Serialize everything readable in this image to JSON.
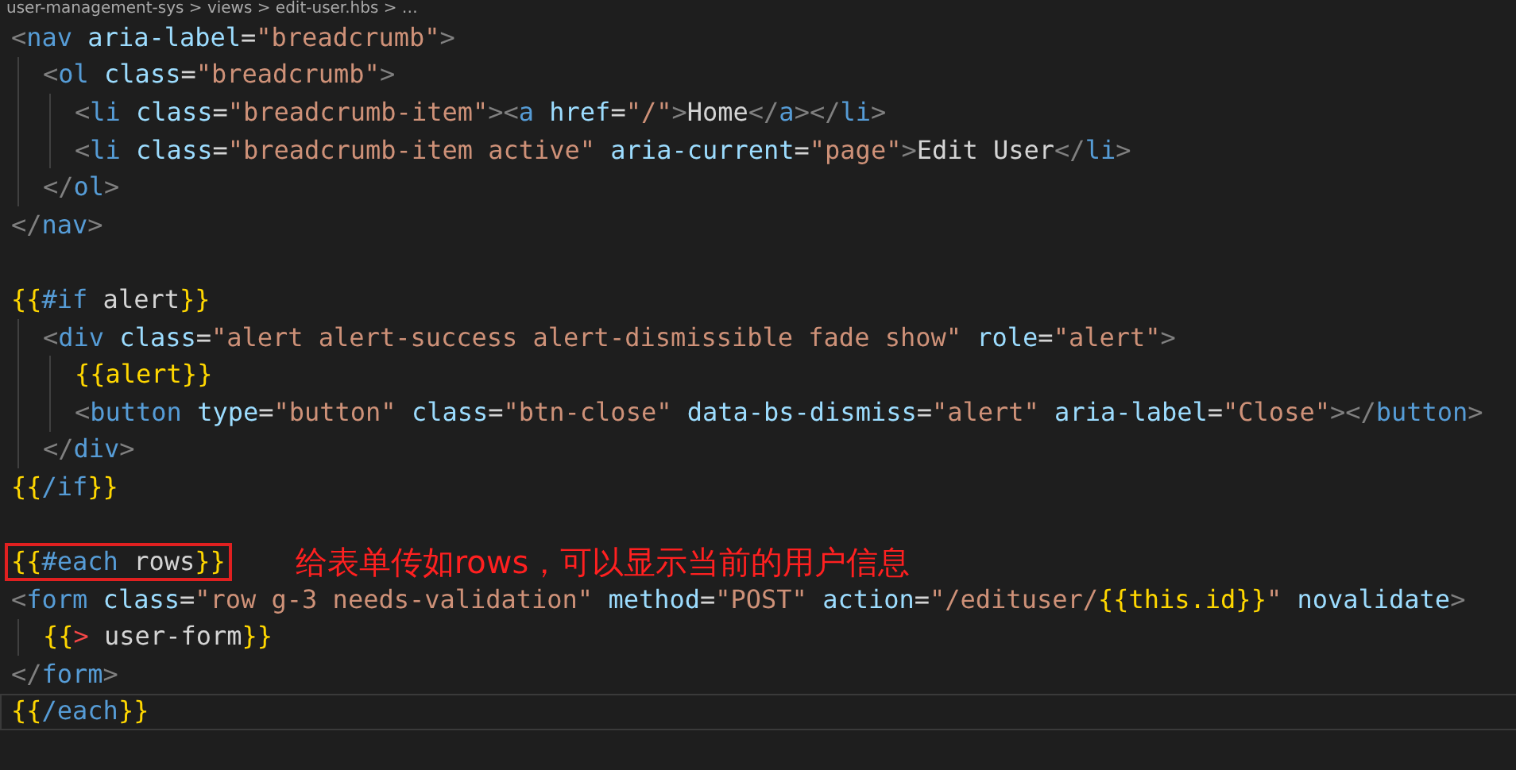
{
  "breadcrumb": "user-management-sys > views > edit-user.hbs > …",
  "lines": [
    {
      "kind": "code",
      "tokens": [
        {
          "kind": "punct",
          "t": "<"
        },
        {
          "kind": "tag",
          "t": "nav"
        },
        {
          "kind": "attr",
          "t": " aria-label"
        },
        {
          "kind": "text",
          "t": "="
        },
        {
          "kind": "str",
          "t": "\"breadcrumb\""
        },
        {
          "kind": "punct",
          "t": ">"
        }
      ],
      "children": [
        {
          "kind": "code",
          "tokens": [
            {
              "kind": "punct",
              "t": "<"
            },
            {
              "kind": "tag",
              "t": "ol"
            },
            {
              "kind": "attr",
              "t": " class"
            },
            {
              "kind": "text",
              "t": "="
            },
            {
              "kind": "str",
              "t": "\"breadcrumb\""
            },
            {
              "kind": "punct",
              "t": ">"
            }
          ],
          "children": [
            {
              "kind": "code",
              "tokens": [
                {
                  "kind": "punct",
                  "t": "<"
                },
                {
                  "kind": "tag",
                  "t": "li"
                },
                {
                  "kind": "attr",
                  "t": " class"
                },
                {
                  "kind": "text",
                  "t": "="
                },
                {
                  "kind": "str",
                  "t": "\"breadcrumb-item\""
                },
                {
                  "kind": "punct",
                  "t": "><"
                },
                {
                  "kind": "tag",
                  "t": "a"
                },
                {
                  "kind": "attr",
                  "t": " href"
                },
                {
                  "kind": "text",
                  "t": "="
                },
                {
                  "kind": "str",
                  "t": "\"/\""
                },
                {
                  "kind": "punct",
                  "t": ">"
                },
                {
                  "kind": "text",
                  "t": "Home"
                },
                {
                  "kind": "punct",
                  "t": "</"
                },
                {
                  "kind": "tag",
                  "t": "a"
                },
                {
                  "kind": "punct",
                  "t": "></"
                },
                {
                  "kind": "tag",
                  "t": "li"
                },
                {
                  "kind": "punct",
                  "t": ">"
                }
              ]
            },
            {
              "kind": "code",
              "tokens": [
                {
                  "kind": "punct",
                  "t": "<"
                },
                {
                  "kind": "tag",
                  "t": "li"
                },
                {
                  "kind": "attr",
                  "t": " class"
                },
                {
                  "kind": "text",
                  "t": "="
                },
                {
                  "kind": "str",
                  "t": "\"breadcrumb-item active\""
                },
                {
                  "kind": "attr",
                  "t": " aria-current"
                },
                {
                  "kind": "text",
                  "t": "="
                },
                {
                  "kind": "str",
                  "t": "\"page\""
                },
                {
                  "kind": "punct",
                  "t": ">"
                },
                {
                  "kind": "text",
                  "t": "Edit User"
                },
                {
                  "kind": "punct",
                  "t": "</"
                },
                {
                  "kind": "tag",
                  "t": "li"
                },
                {
                  "kind": "punct",
                  "t": ">"
                }
              ]
            }
          ]
        },
        {
          "kind": "code",
          "tokens": [
            {
              "kind": "punct",
              "t": "</"
            },
            {
              "kind": "tag",
              "t": "ol"
            },
            {
              "kind": "punct",
              "t": ">"
            }
          ]
        }
      ]
    },
    {
      "kind": "code",
      "tokens": [
        {
          "kind": "punct",
          "t": "</"
        },
        {
          "kind": "tag",
          "t": "nav"
        },
        {
          "kind": "punct",
          "t": ">"
        }
      ]
    },
    {
      "kind": "blank"
    },
    {
      "kind": "code",
      "tokens": [
        {
          "kind": "brace",
          "t": "{{"
        },
        {
          "kind": "kw",
          "t": "#if"
        },
        {
          "kind": "text",
          "t": " alert"
        },
        {
          "kind": "brace",
          "t": "}}"
        }
      ],
      "children": [
        {
          "kind": "code",
          "tokens": [
            {
              "kind": "punct",
              "t": "<"
            },
            {
              "kind": "tag",
              "t": "div"
            },
            {
              "kind": "attr",
              "t": " class"
            },
            {
              "kind": "text",
              "t": "="
            },
            {
              "kind": "str",
              "t": "\"alert alert-success alert-dismissible fade show\""
            },
            {
              "kind": "attr",
              "t": " role"
            },
            {
              "kind": "text",
              "t": "="
            },
            {
              "kind": "str",
              "t": "\"alert\""
            },
            {
              "kind": "punct",
              "t": ">"
            }
          ],
          "children": [
            {
              "kind": "code",
              "tokens": [
                {
                  "kind": "brace",
                  "t": "{{alert}}"
                }
              ]
            },
            {
              "kind": "code",
              "tokens": [
                {
                  "kind": "punct",
                  "t": "<"
                },
                {
                  "kind": "tag",
                  "t": "button"
                },
                {
                  "kind": "attr",
                  "t": " type"
                },
                {
                  "kind": "text",
                  "t": "="
                },
                {
                  "kind": "str",
                  "t": "\"button\""
                },
                {
                  "kind": "attr",
                  "t": " class"
                },
                {
                  "kind": "text",
                  "t": "="
                },
                {
                  "kind": "str",
                  "t": "\"btn-close\""
                },
                {
                  "kind": "attr",
                  "t": " data-bs-dismiss"
                },
                {
                  "kind": "text",
                  "t": "="
                },
                {
                  "kind": "str",
                  "t": "\"alert\""
                },
                {
                  "kind": "attr",
                  "t": " aria-label"
                },
                {
                  "kind": "text",
                  "t": "="
                },
                {
                  "kind": "str",
                  "t": "\"Close\""
                },
                {
                  "kind": "punct",
                  "t": "></"
                },
                {
                  "kind": "tag",
                  "t": "button"
                },
                {
                  "kind": "punct",
                  "t": ">"
                }
              ]
            }
          ]
        },
        {
          "kind": "code",
          "tokens": [
            {
              "kind": "punct",
              "t": "</"
            },
            {
              "kind": "tag",
              "t": "div"
            },
            {
              "kind": "punct",
              "t": ">"
            }
          ]
        }
      ]
    },
    {
      "kind": "code",
      "tokens": [
        {
          "kind": "brace",
          "t": "{{"
        },
        {
          "kind": "kw",
          "t": "/if"
        },
        {
          "kind": "brace",
          "t": "}}"
        }
      ]
    },
    {
      "kind": "blank"
    },
    {
      "kind": "code",
      "boxed": true,
      "note": "给表单传如rows，可以显示当前的用户信息",
      "tokens": [
        {
          "kind": "brace",
          "t": "{{"
        },
        {
          "kind": "kw",
          "t": "#each"
        },
        {
          "kind": "text",
          "t": " rows"
        },
        {
          "kind": "brace",
          "t": "}}"
        }
      ]
    },
    {
      "kind": "code",
      "tokens": [
        {
          "kind": "punct",
          "t": "<"
        },
        {
          "kind": "tag",
          "t": "form"
        },
        {
          "kind": "attr",
          "t": " class"
        },
        {
          "kind": "text",
          "t": "="
        },
        {
          "kind": "str",
          "t": "\"row g-3 needs-validation\""
        },
        {
          "kind": "attr",
          "t": " method"
        },
        {
          "kind": "text",
          "t": "="
        },
        {
          "kind": "str",
          "t": "\"POST\""
        },
        {
          "kind": "attr",
          "t": " action"
        },
        {
          "kind": "text",
          "t": "="
        },
        {
          "kind": "str",
          "t": "\"/edituser/"
        },
        {
          "kind": "brace",
          "t": "{{this.id}}"
        },
        {
          "kind": "str",
          "t": "\""
        },
        {
          "kind": "attr",
          "t": " novalidate"
        },
        {
          "kind": "punct",
          "t": ">"
        }
      ],
      "children": [
        {
          "kind": "code",
          "tokens": [
            {
              "kind": "brace",
              "t": "{{"
            },
            {
              "kind": "partial",
              "t": ">"
            },
            {
              "kind": "text",
              "t": " user-form"
            },
            {
              "kind": "brace",
              "t": "}}"
            }
          ]
        }
      ]
    },
    {
      "kind": "code",
      "tokens": [
        {
          "kind": "punct",
          "t": "</"
        },
        {
          "kind": "tag",
          "t": "form"
        },
        {
          "kind": "punct",
          "t": ">"
        }
      ]
    },
    {
      "kind": "code",
      "current": true,
      "tokens": [
        {
          "kind": "brace",
          "t": "{{"
        },
        {
          "kind": "kw",
          "t": "/each"
        },
        {
          "kind": "brace",
          "t": "}}"
        }
      ]
    }
  ]
}
